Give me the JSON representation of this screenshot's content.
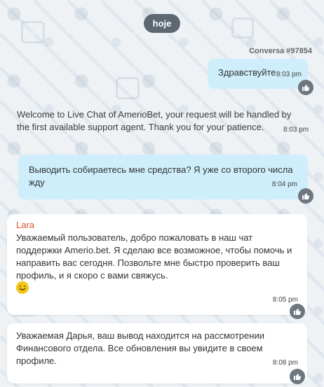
{
  "day_separator": "hoje",
  "conversation_id": "Conversa #97854",
  "messages": [
    {
      "text": "Здравствуйте",
      "time": "8:03 pm"
    },
    {
      "text": "Welcome to Live Chat of AmerioBet, your request will be handled by the first available support agent. Thank you for your patience.",
      "time": "8:03 pm"
    },
    {
      "text": "Выводить собираетесь мне средства? Я уже со второго числа жду",
      "time": "8:04 pm"
    },
    {
      "agent": "Lara",
      "text": "Уважаемый пользователь, добро пожаловать в наш чат поддержки Amerio.bet. Я сделаю все возможное, чтобы помочь и направить вас сегодня. Позвольте мне быстро проверить ваш профиль, и я скоро с вами свяжусь.",
      "emoji": "slightly-smiling-face-icon",
      "time": "8:05 pm"
    },
    {
      "text": "Уважаемая Дарья, ваш вывод находится на рассмотрении Финансового отдела. Все обновления вы увидите в своем профиле.",
      "time": "8:08 pm"
    }
  ],
  "icons": {
    "like": "thumbs-up-icon"
  },
  "colors": {
    "background": "#eef2f5",
    "outgoing_bubble": "#cfeefb",
    "incoming_bubble": "#ffffff",
    "day_pill": "#5d6872",
    "agent_name": "#e0522d",
    "like_button": "#6e7780"
  }
}
